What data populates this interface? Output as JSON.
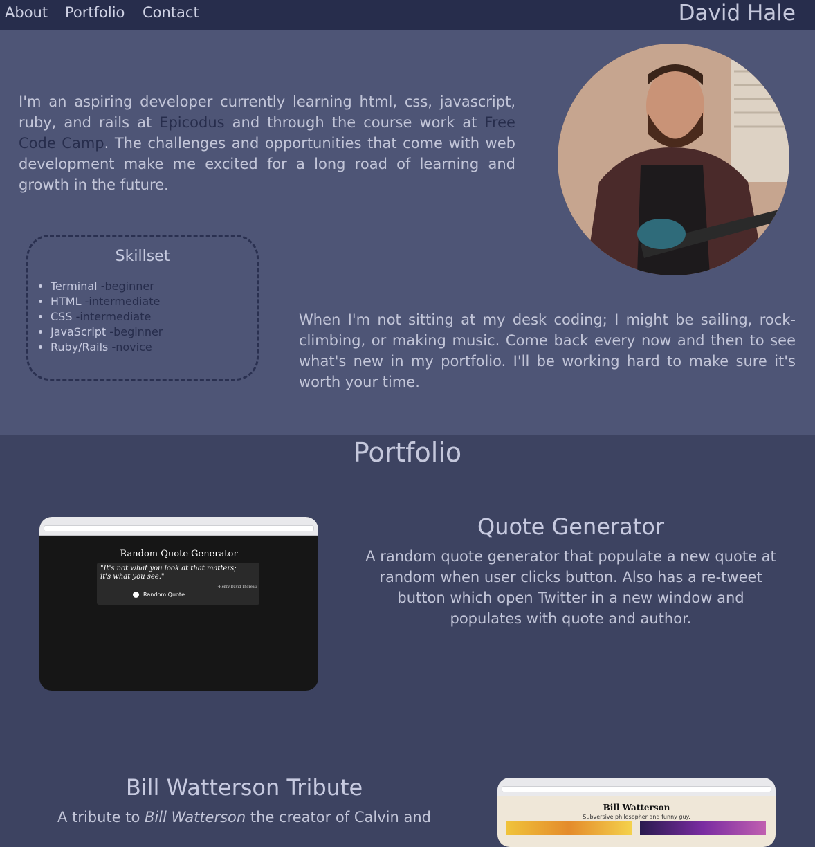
{
  "nav": {
    "links": [
      "About",
      "Portfolio",
      "Contact"
    ],
    "brand": "David Hale"
  },
  "about": {
    "intro": {
      "part1": "I'm an aspiring developer currently learning html, css, javascript, ruby, and rails at ",
      "link1": "Epicodus",
      "part2": " and through the course work at ",
      "link2": "Free Code Camp",
      "part3": ". The challenges and opportunities that come with web development make me excited for a long road of learning and growth in the future."
    },
    "skillset": {
      "title": "Skillset",
      "items": [
        {
          "name": "Terminal",
          "level": "-beginner"
        },
        {
          "name": "HTML",
          "level": "-intermediate"
        },
        {
          "name": "CSS",
          "level": "-intermediate"
        },
        {
          "name": "JavaScript",
          "level": "-beginner"
        },
        {
          "name": "Ruby/Rails",
          "level": "-novice"
        }
      ]
    },
    "outro": "When I'm not sitting at my desk coding; I might be sailing, rock-climbing, or making music. Come back every now and then to see what's new in my portfolio. I'll be working hard to make sure it's worth your time."
  },
  "portfolio": {
    "title": "Portfolio",
    "projects": [
      {
        "title": "Quote Generator",
        "description": "A random quote generator that populate a new quote at random when user clicks button. Also has a re-tweet button which open Twitter in a new window and populates with quote and author.",
        "screenshot": {
          "heading": "Random Quote Generator",
          "quote": "\"It's not what you look at that matters; it's what you see.\"",
          "author": "-Henry David Thoreau",
          "button": "Random Quote"
        }
      },
      {
        "title": "Bill Watterson Tribute",
        "description_pre": "A tribute to ",
        "description_em": "Bill Watterson",
        "description_post": " the creator of Calvin and",
        "screenshot": {
          "heading": "Bill Watterson",
          "subtitle": "Subversive philosopher and funny guy."
        }
      }
    ]
  }
}
